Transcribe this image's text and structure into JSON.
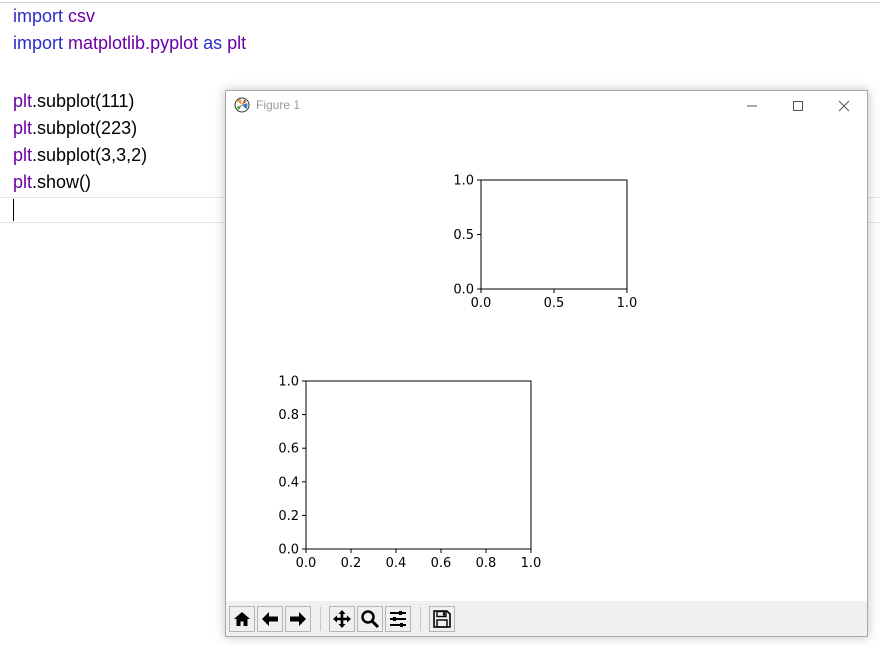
{
  "editor": {
    "lines": [
      {
        "kw": "import",
        "mod": "csv",
        "rest": ""
      },
      {
        "kw": "import",
        "mod": "matplotlib.pyplot",
        "kw2": "as",
        "alias": "plt"
      },
      {
        "blank": ""
      },
      {
        "obj": "plt",
        "call": ".subplot(111)"
      },
      {
        "obj": "plt",
        "call": ".subplot(223)"
      },
      {
        "obj": "plt",
        "call": ".subplot(3,3,2)"
      },
      {
        "obj": "plt",
        "call": ".show()"
      }
    ]
  },
  "figure_window": {
    "title": "Figure 1"
  },
  "chart_data": [
    {
      "type": "line",
      "subplot": "3,3,2",
      "xlim": [
        0.0,
        1.0
      ],
      "ylim": [
        0.0,
        1.0
      ],
      "xticks": [
        "0.0",
        "0.5",
        "1.0"
      ],
      "yticks": [
        "0.0",
        "0.5",
        "1.0"
      ],
      "series": []
    },
    {
      "type": "line",
      "subplot": "223",
      "xlim": [
        0.0,
        1.0
      ],
      "ylim": [
        0.0,
        1.0
      ],
      "xticks": [
        "0.0",
        "0.2",
        "0.4",
        "0.6",
        "0.8",
        "1.0"
      ],
      "yticks": [
        "0.0",
        "0.2",
        "0.4",
        "0.6",
        "0.8",
        "1.0"
      ],
      "series": []
    }
  ],
  "toolbar": {
    "icons": [
      "home-icon",
      "back-icon",
      "forward-icon",
      "pan-icon",
      "zoom-icon",
      "subplots-icon",
      "save-icon"
    ]
  }
}
